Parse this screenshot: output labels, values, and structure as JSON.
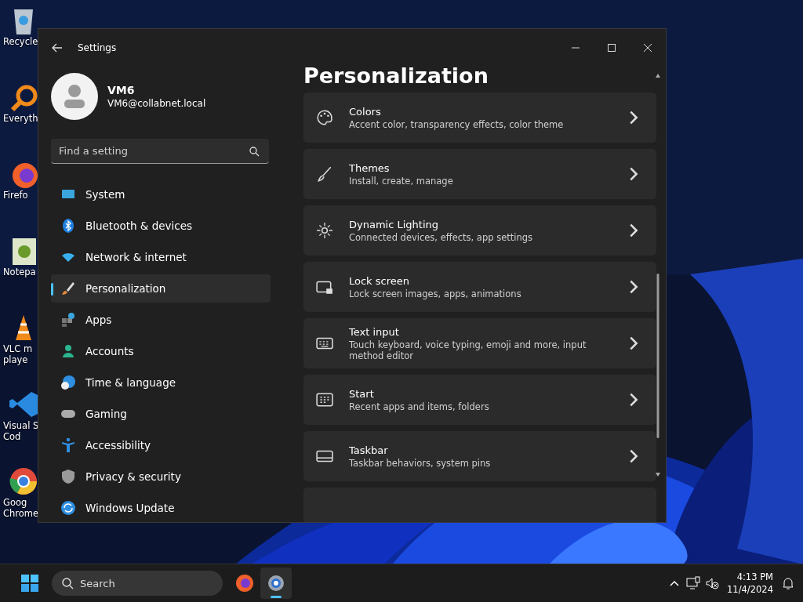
{
  "desktop": {
    "icons": [
      {
        "label": "Recycle"
      },
      {
        "label": "Everyth"
      },
      {
        "label": "Firefo"
      },
      {
        "label": "Notepa"
      },
      {
        "label": "VLC m",
        "label_2": "playe"
      },
      {
        "label": "Visual S",
        "label_2": "Cod"
      },
      {
        "label": "Goog",
        "label_2": "Chrome"
      }
    ]
  },
  "window": {
    "title": "Settings",
    "profile": {
      "name": "VM6",
      "email": "VM6@collabnet.local"
    },
    "search": {
      "placeholder": "Find a setting"
    },
    "sidebar": {
      "items": [
        {
          "label": "System",
          "selected": false
        },
        {
          "label": "Bluetooth & devices",
          "selected": false
        },
        {
          "label": "Network & internet",
          "selected": false
        },
        {
          "label": "Personalization",
          "selected": true
        },
        {
          "label": "Apps",
          "selected": false
        },
        {
          "label": "Accounts",
          "selected": false
        },
        {
          "label": "Time & language",
          "selected": false
        },
        {
          "label": "Gaming",
          "selected": false
        },
        {
          "label": "Accessibility",
          "selected": false
        },
        {
          "label": "Privacy & security",
          "selected": false
        },
        {
          "label": "Windows Update",
          "selected": false
        }
      ]
    },
    "page_title": "Personalization",
    "cards": [
      {
        "title": "Colors",
        "description": "Accent color, transparency effects, color theme"
      },
      {
        "title": "Themes",
        "description": "Install, create, manage"
      },
      {
        "title": "Dynamic Lighting",
        "description": "Connected devices, effects, app settings"
      },
      {
        "title": "Lock screen",
        "description": "Lock screen images, apps, animations"
      },
      {
        "title": "Text input",
        "description": "Touch keyboard, voice typing, emoji and more, input method editor"
      },
      {
        "title": "Start",
        "description": "Recent apps and items, folders"
      },
      {
        "title": "Taskbar",
        "description": "Taskbar behaviors, system pins"
      }
    ]
  },
  "taskbar": {
    "search": {
      "placeholder": "Search"
    },
    "apps": [
      {
        "selected": false
      },
      {
        "selected": true
      }
    ],
    "time": "4:13 PM",
    "date": "11/4/2024"
  }
}
